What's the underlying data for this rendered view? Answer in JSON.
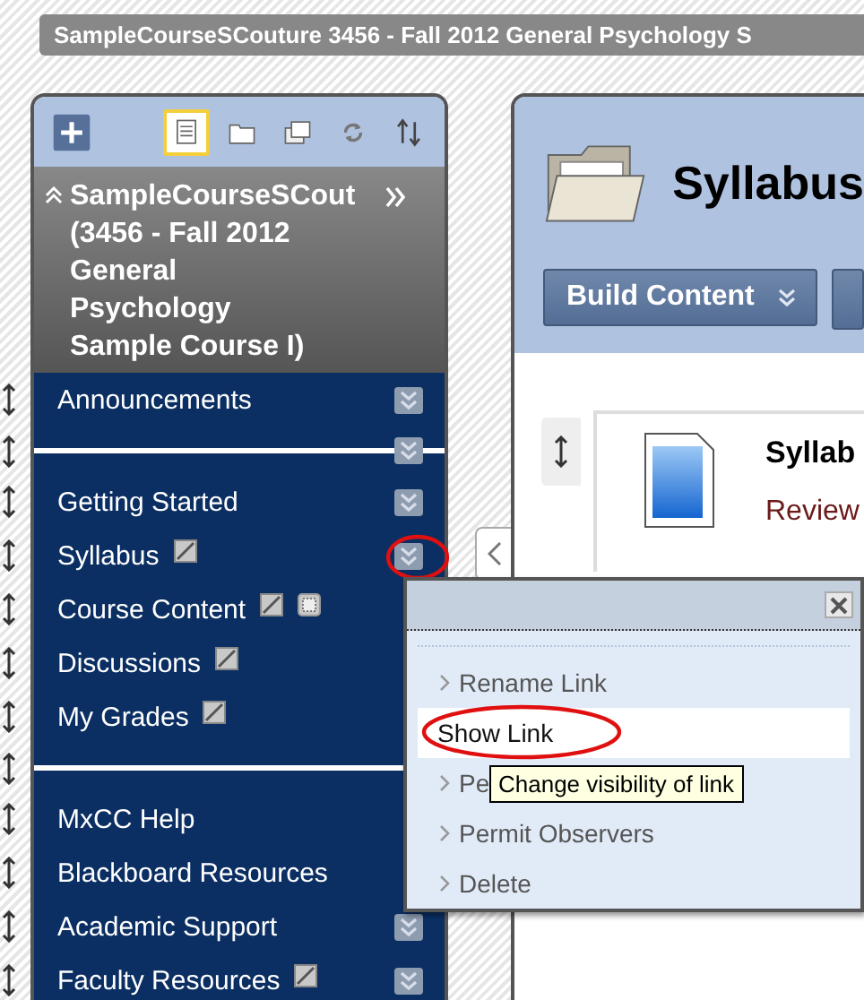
{
  "breadcrumb": {
    "text": "SampleCourseSCouture 3456 - Fall 2012 General Psychology S"
  },
  "course_menu": {
    "toolbar": [
      {
        "kind": "add",
        "selected": false
      },
      {
        "kind": "list",
        "selected": true
      },
      {
        "kind": "folder",
        "selected": false
      },
      {
        "kind": "window",
        "selected": false
      },
      {
        "kind": "refresh",
        "selected": false
      },
      {
        "kind": "sort",
        "selected": false
      }
    ],
    "title": "SampleCourseSCout\n(3456 - Fall 2012\nGeneral\nPsychology\nSample Course I)",
    "items": [
      {
        "kind": "link",
        "label": "Announcements",
        "hidden": false,
        "status_icon": false,
        "chevron": true,
        "circled": false
      },
      {
        "kind": "divider",
        "chevron": true
      },
      {
        "kind": "link",
        "label": "Getting Started",
        "hidden": false,
        "status_icon": false,
        "chevron": true,
        "circled": false
      },
      {
        "kind": "link",
        "label": "Syllabus",
        "hidden": true,
        "status_icon": false,
        "chevron": true,
        "circled": true
      },
      {
        "kind": "link",
        "label": "Course Content",
        "hidden": true,
        "status_icon": true,
        "chevron": false,
        "circled": false
      },
      {
        "kind": "link",
        "label": "Discussions",
        "hidden": true,
        "status_icon": false,
        "chevron": false,
        "circled": false
      },
      {
        "kind": "link",
        "label": "My Grades",
        "hidden": true,
        "status_icon": false,
        "chevron": false,
        "circled": false
      },
      {
        "kind": "divider",
        "chevron": false
      },
      {
        "kind": "link",
        "label": "MxCC Help",
        "hidden": false,
        "status_icon": false,
        "chevron": false,
        "circled": false
      },
      {
        "kind": "link",
        "label": "Blackboard Resources",
        "hidden": false,
        "status_icon": false,
        "chevron": false,
        "circled": false
      },
      {
        "kind": "link",
        "label": "Academic Support",
        "hidden": false,
        "status_icon": false,
        "chevron": true,
        "circled": false
      },
      {
        "kind": "link",
        "label": "Faculty Resources",
        "hidden": true,
        "status_icon": false,
        "chevron": true,
        "circled": false
      }
    ]
  },
  "content_area": {
    "title": "Syllabus",
    "buttons": [
      "Build Content"
    ],
    "items": [
      {
        "title": "Syllab",
        "description": "Review"
      }
    ]
  },
  "context_menu": {
    "items": [
      {
        "label": "Rename Link",
        "selected": false,
        "circled": false
      },
      {
        "label": "Show Link",
        "selected": true,
        "circled": true
      },
      {
        "label": "Pe",
        "selected": false,
        "circled": false
      },
      {
        "label": "Permit Observers",
        "selected": false,
        "circled": false
      },
      {
        "label": "Delete",
        "selected": false,
        "circled": false
      }
    ]
  },
  "tooltip": {
    "text": "Change visibility of link"
  }
}
